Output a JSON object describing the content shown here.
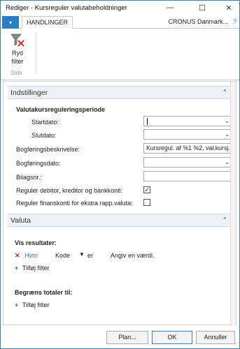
{
  "window": {
    "title": "Rediger - Kursreguler valutabeholdninger",
    "minimize_glyph": "—",
    "maximize_glyph": "☐",
    "close_glyph": "✕"
  },
  "ribbon": {
    "file_glyph": "▾",
    "active_tab": "HANDLINGER",
    "company": "CRONUS Danmark...",
    "help_glyph": "?",
    "clear_filter_label_1": "Ryd",
    "clear_filter_label_2": "filter",
    "group_label": "Side"
  },
  "settings": {
    "header": "Indstillinger",
    "collapse_glyph": "⌃",
    "group_title": "Valutakursreguleringsperiode",
    "fields": {
      "start_date": {
        "label": "Startdato:",
        "value": ""
      },
      "end_date": {
        "label": "Slutdato:",
        "value": ""
      },
      "posting_description": {
        "label": "Bogføringsbeskrivelse:",
        "value": "Kursregul. af %1 %2, val.kursj..."
      },
      "posting_date": {
        "label": "Bogføringsdato:",
        "value": ""
      },
      "document_no": {
        "label": "Bilagsnr.:",
        "value": ""
      },
      "adjust_cust_vend_bank": {
        "label": "Reguler debitor, kreditor og bankkonti:",
        "checked": true
      },
      "adjust_gl_accounts": {
        "label": "Reguler finanskonti for ekstra rapp.valuta:",
        "checked": false
      }
    }
  },
  "currency": {
    "header": "Valuta",
    "collapse_glyph": "⌃",
    "show_results_title": "Vis resultater:",
    "remove_glyph": "✕",
    "where_label": "Hvor",
    "field_name": "Kode",
    "operator": "er",
    "value_placeholder": "Angiv en værdi.",
    "add_filter_glyph": "+",
    "add_filter_label": "Tilføj filter",
    "limit_totals_title": "Begræns totaler til:",
    "add_filter_label_2": "Tilføj filter"
  },
  "buttons": {
    "plan": "Plan...",
    "ok": "OK",
    "cancel": "Annuller"
  },
  "colors": {
    "accent": "#2d7dc4",
    "remove_red": "#d23333",
    "add_green": "#2a8a2a"
  },
  "icons": {
    "clear_filter": "funnel-with-red-x-icon"
  }
}
